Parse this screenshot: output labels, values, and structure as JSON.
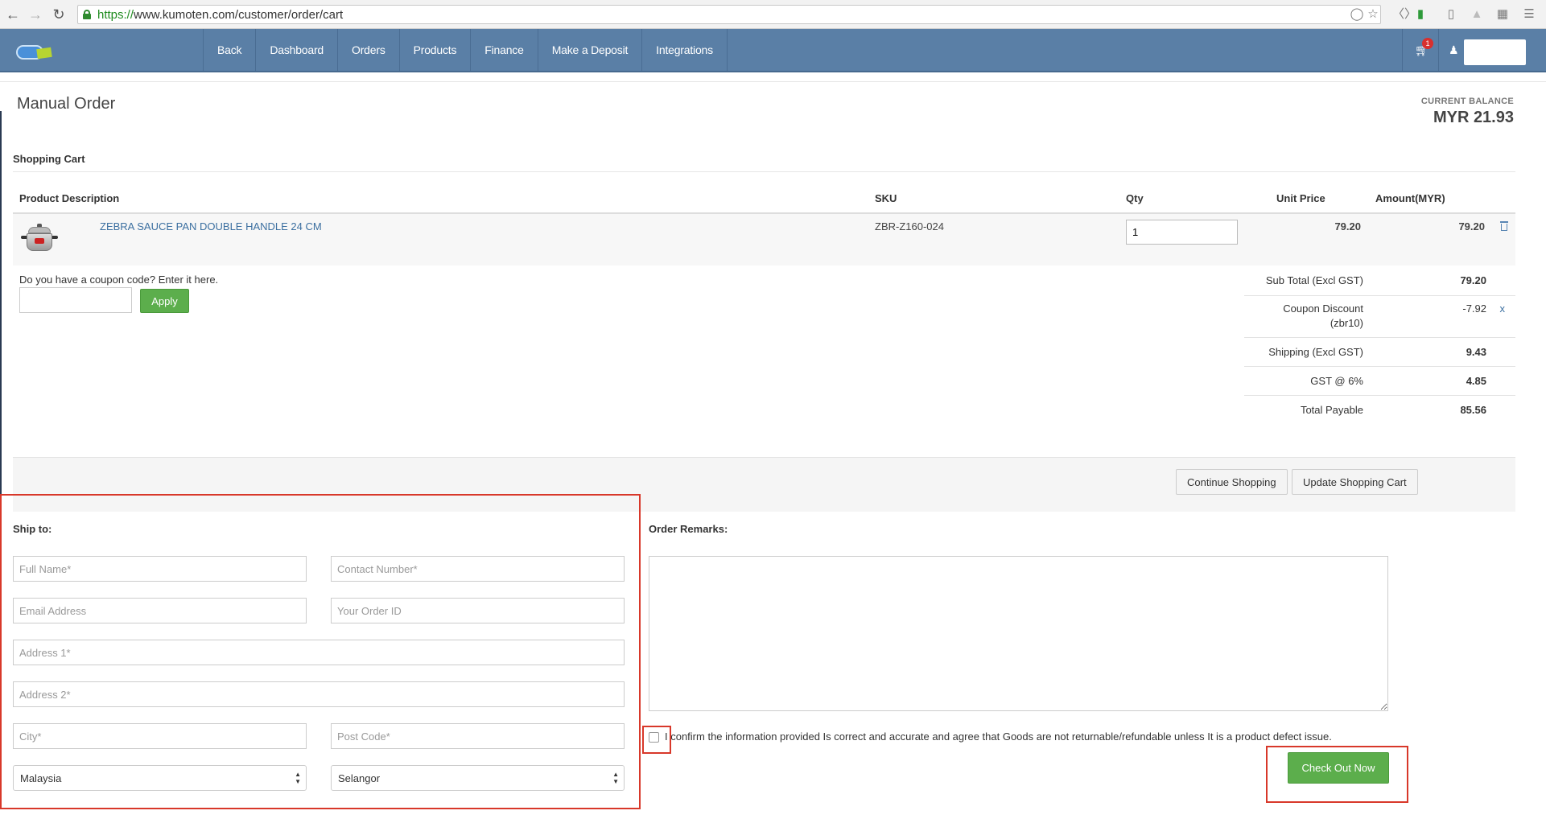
{
  "browser": {
    "url_scheme": "https://",
    "url_rest": "www.kumoten.com/customer/order/cart"
  },
  "nav": {
    "items": [
      "Back",
      "Dashboard",
      "Orders",
      "Products",
      "Finance",
      "Make a Deposit",
      "Integrations"
    ],
    "cart_count": "1"
  },
  "page": {
    "title": "Manual Order",
    "balance_label": "CURRENT BALANCE",
    "balance_value": "MYR 21.93"
  },
  "cart": {
    "title": "Shopping Cart",
    "headers": {
      "product": "Product Description",
      "sku": "SKU",
      "qty": "Qty",
      "unit_price": "Unit Price",
      "amount": "Amount(MYR)"
    },
    "item": {
      "name": "ZEBRA SAUCE PAN DOUBLE HANDLE 24 CM",
      "sku": "ZBR-Z160-024",
      "qty": "1",
      "unit_price": "79.20",
      "amount": "79.20"
    },
    "coupon_prompt": "Do you have a coupon code? Enter it here.",
    "apply_label": "Apply"
  },
  "summary": {
    "subtotal_label": "Sub Total (Excl GST)",
    "subtotal": "79.20",
    "coupon_label_1": "Coupon Discount",
    "coupon_label_2": "(zbr10)",
    "coupon": "-7.92",
    "coupon_remove": "x",
    "shipping_label": "Shipping (Excl GST)",
    "shipping": "9.43",
    "gst_label": "GST @ 6%",
    "gst": "4.85",
    "total_label": "Total Payable",
    "total": "85.56"
  },
  "actions": {
    "continue": "Continue Shopping",
    "update": "Update Shopping Cart"
  },
  "ship": {
    "title": "Ship to:",
    "full_name": "Full Name*",
    "contact": "Contact Number*",
    "email": "Email Address",
    "order_id": "Your Order ID",
    "address1": "Address 1*",
    "address2": "Address 2*",
    "city": "City*",
    "postcode": "Post Code*",
    "country": "Malaysia",
    "state": "Selangor"
  },
  "remarks": {
    "title": "Order Remarks:"
  },
  "confirm": {
    "text": "I confirm the information provided Is correct and accurate and agree that Goods are not returnable/refundable unless It is a product defect issue.",
    "checkout": "Check Out Now"
  },
  "colors": {
    "navbar": "#5a7fa6",
    "green_button": "#5cae4c",
    "highlight": "#d8382a",
    "link": "#3b6fa0"
  }
}
